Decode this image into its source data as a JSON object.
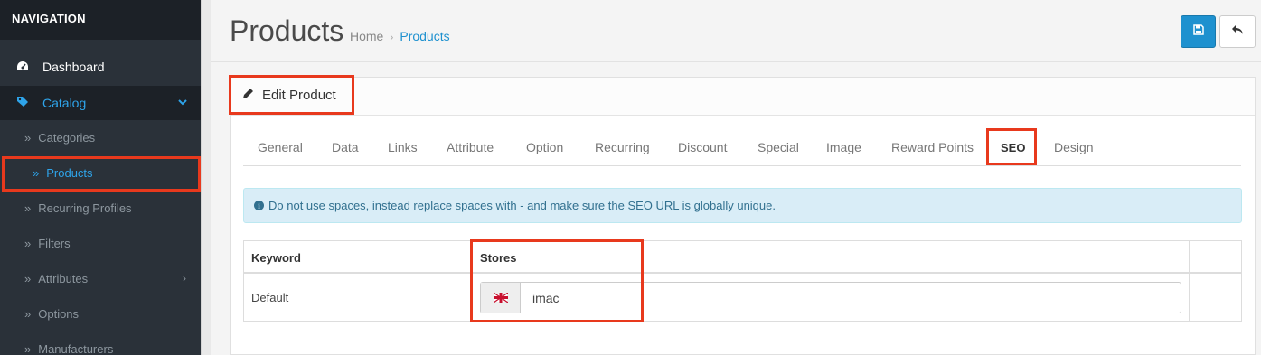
{
  "sidebar": {
    "header": "NAVIGATION",
    "dashboard": "Dashboard",
    "catalog": "Catalog",
    "items": [
      {
        "label": "Categories"
      },
      {
        "label": "Products"
      },
      {
        "label": "Recurring Profiles"
      },
      {
        "label": "Filters"
      },
      {
        "label": "Attributes"
      },
      {
        "label": "Options"
      },
      {
        "label": "Manufacturers"
      }
    ]
  },
  "header": {
    "title": "Products",
    "breadcrumb": {
      "home": "Home",
      "separator": "›",
      "current": "Products"
    }
  },
  "panel": {
    "title": "Edit Product",
    "tabs": [
      "General",
      "Data",
      "Links",
      "Attribute",
      "Option",
      "Recurring",
      "Discount",
      "Special",
      "Image",
      "Reward Points",
      "SEO",
      "Design"
    ],
    "active_tab": "SEO",
    "alert": "Do not use spaces, instead replace spaces with - and make sure the SEO URL is globally unique.",
    "table": {
      "headers": [
        "Keyword",
        "Stores"
      ],
      "row": {
        "store": "Default",
        "keyword_value": "imac"
      }
    }
  },
  "colors": {
    "primary": "#1e91cf",
    "sidebar": "#2a3139",
    "highlight": "#e8391d",
    "alert_bg": "#d9edf7"
  },
  "icons": [
    "dashboard-icon",
    "tag-icon",
    "chevron-down-icon",
    "double-chevron-icon",
    "chevron-right-icon",
    "save-icon",
    "reply-icon",
    "pencil-icon",
    "info-icon",
    "uk-flag-icon"
  ]
}
